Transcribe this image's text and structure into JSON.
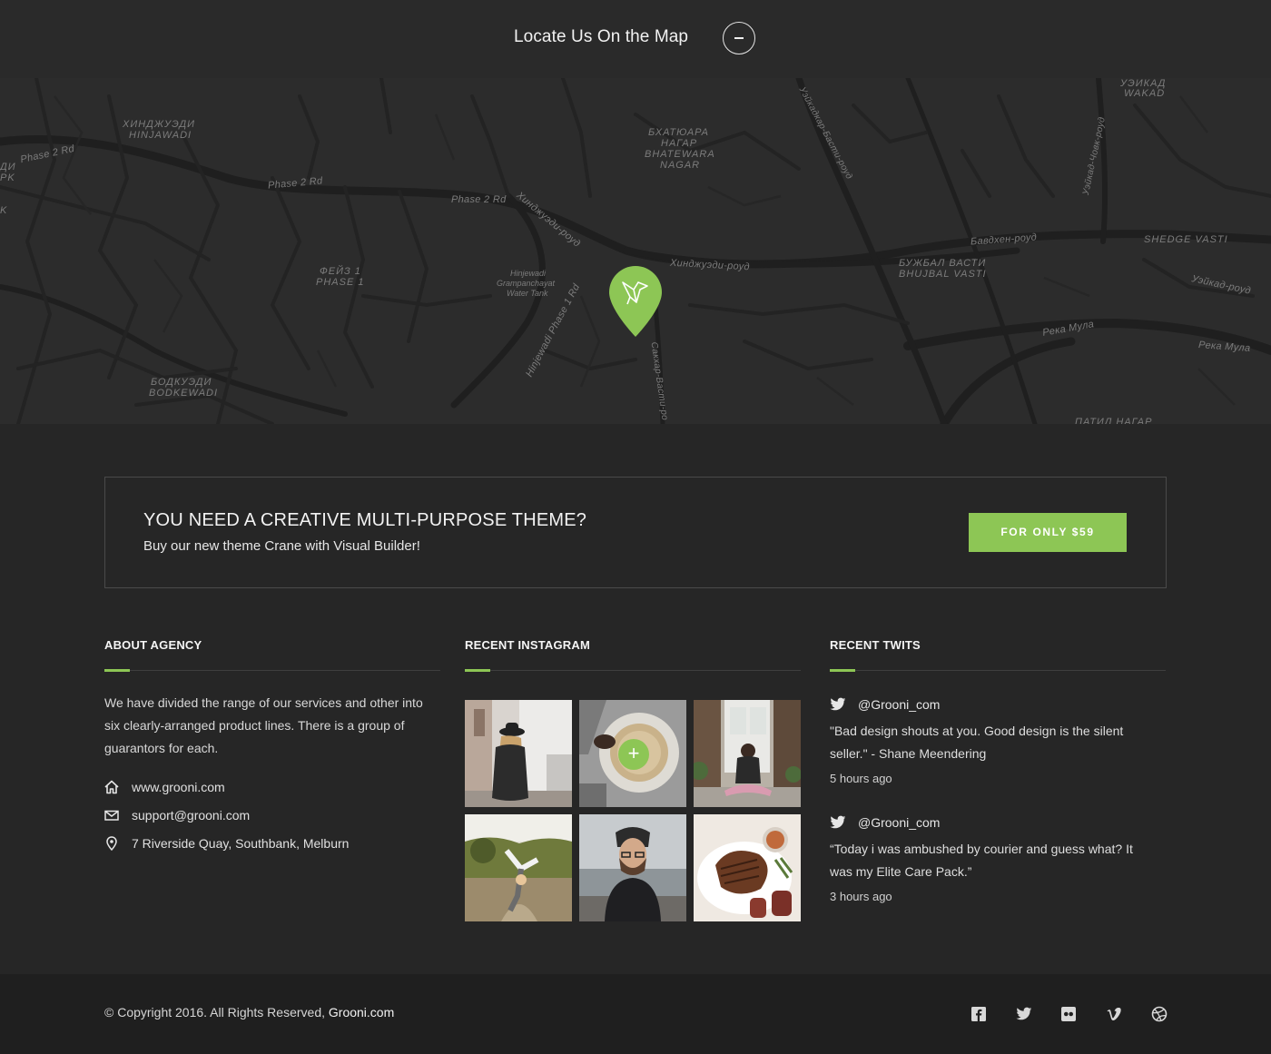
{
  "map_section": {
    "title": "Locate Us On the Map",
    "toggle_icon": "minus-circle-icon",
    "labels": {
      "hinjawadi_ru": "ХИНДЖУЭДИ",
      "hinjawadi": "HINJAWADI",
      "phase2_a": "Phase 2 Rd",
      "phase2_b": "Phase 2 Rd",
      "phase2_c": "Phase 2 Rd",
      "bhatewara_ru1": "БХАТЮАРА",
      "bhatewara_ru2": "НАГАР",
      "bhatewara1": "BHATEWARA",
      "bhatewara2": "NAGAR",
      "wakad_ru": "УЭИКАД",
      "wakad": "WAKAD",
      "phase1_ru": "ФЕЙЗ 1",
      "phase1": "PHASE 1",
      "hinj_road": "Хинджуэди-роуд",
      "hinj_road2": "Хинджуэди-роуд",
      "gram1": "Hinjewadi",
      "gram2": "Grampanchayat",
      "gram3": "Water Tank",
      "hinj_phase1": "Hinjewadi Phase 1 Rd",
      "bhujbal_ru": "БУЖБАЛ ВАСТИ",
      "bhujbal": "BHUJBAL VASTI",
      "shedge": "SHEDGE VASTI",
      "bavdhan": "Бавдхен-роуд",
      "wakad_road": "Уэйкад-роуд",
      "mula1": "Река Мула",
      "mula2": "Река Мула",
      "bodkewadi_ru": "БОДКУЭДИ",
      "bodkewadi": "BODKEWADI",
      "sakhar": "Сакхар-Васти-ро",
      "wakadkar": "Уэйкадкар-Басти-роуд",
      "wakad_chowk": "Уэйкад-Човк-роуд",
      "left_edge1": "ДИ",
      "left_edge2": "PK",
      "left_edge3": "K",
      "bottom_cut": "ПАТИЛ НАГАР"
    }
  },
  "cta": {
    "title": "YOU NEED A CREATIVE MULTI-PURPOSE THEME?",
    "subtitle": "Buy our new theme Crane with Visual Builder!",
    "button_label": "FOR ONLY $59",
    "accent_color": "#8dc655"
  },
  "about": {
    "title": "ABOUT AGENCY",
    "text": "We have divided the range of our services and other into six  clearly-arranged product lines. There is a group of guarantors for each.",
    "website": "www.grooni.com",
    "email": "support@grooni.com",
    "address": "7 Riverside Quay, Southbank, Melburn",
    "icons": [
      "home-icon",
      "envelope-icon",
      "map-marker-icon"
    ]
  },
  "instagram": {
    "title": "RECENT INSTAGRAM",
    "plus_label": "+",
    "photos": [
      "woman-hat-photo",
      "coffee-cup-photo",
      "yoga-woman-photo",
      "child-cartwheel-photo",
      "bearded-man-photo",
      "steak-plate-photo"
    ]
  },
  "twits": {
    "title": "RECENT TWITS",
    "items": [
      {
        "handle": "@Grooni_com",
        "text": "\"Bad design shouts at you. Good design is the silent seller.\" - Shane Meendering",
        "time": "5 hours ago"
      },
      {
        "handle": "@Grooni_com",
        "text": "“Today i was ambushed by courier and guess what? It was my Elite Care Pack.”",
        "time": "3 hours ago"
      }
    ]
  },
  "footer": {
    "copyright": "© Copyright 2016. All Rights Reserved, ",
    "brand": "Grooni.com",
    "social_icons": [
      "facebook-icon",
      "twitter-icon",
      "flickr-icon",
      "vimeo-icon",
      "dribbble-icon"
    ]
  }
}
